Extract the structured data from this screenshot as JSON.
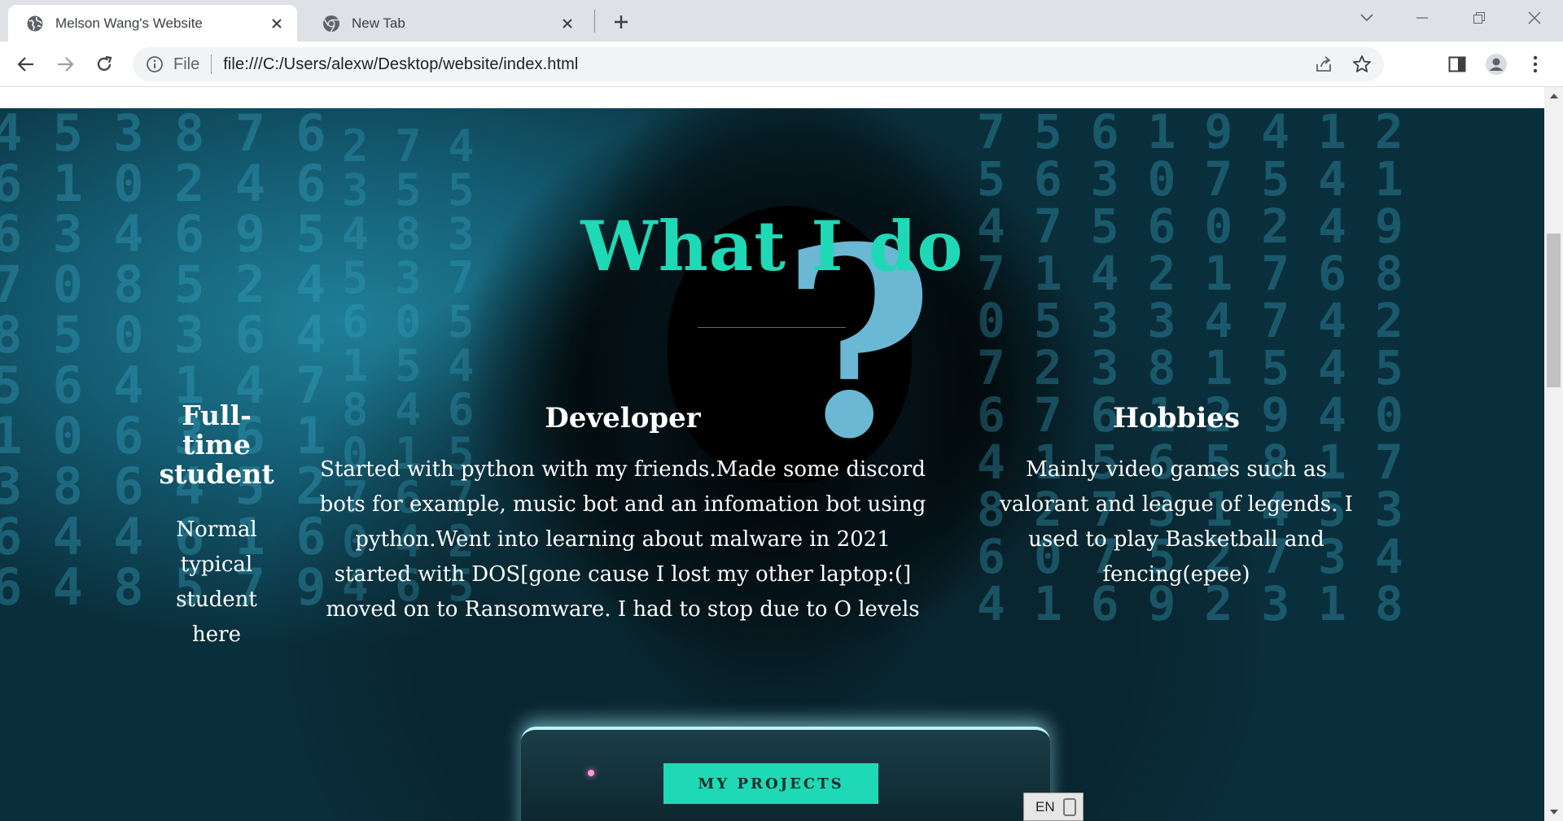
{
  "browser": {
    "tabs": [
      {
        "title": "Melson Wang's Website",
        "icon": "globe-icon",
        "active": true
      },
      {
        "title": "New Tab",
        "icon": "chrome-icon",
        "active": false
      }
    ],
    "omnibox": {
      "scheme_label": "File",
      "url": "file:///C:/Users/alexw/Desktop/website/index.html"
    }
  },
  "page": {
    "section_title": "What I do",
    "columns": [
      {
        "title": "Full-time student",
        "text": "Normal typical student here"
      },
      {
        "title": "Developer",
        "text": "Started with python with my friends.Made some discord bots for example, music bot and an infomation bot using python.Went into learning about malware in 2021 started with DOS[gone cause I lost my other laptop:(] moved on to Ransomware. I had to stop due to O levels"
      },
      {
        "title": "Hobbies",
        "text": "Mainly video games such as valorant and league of legends. I used to play Basketball and fencing(epee)"
      }
    ],
    "cta_label": "MY PROJECTS",
    "background_image": "hooded-hacker-question-mark-matrix-digits"
  },
  "system": {
    "ime_label": "EN"
  },
  "colors": {
    "accent": "#1fd8b6",
    "tabstrip": "#dee1e6",
    "omnibox": "#f1f3f4"
  }
}
